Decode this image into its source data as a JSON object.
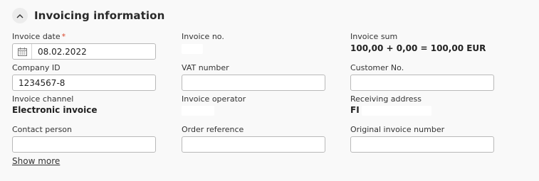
{
  "section": {
    "title": "Invoicing information",
    "collapse_icon": "chevron-up-icon"
  },
  "fields": {
    "invoice_date": {
      "label": "Invoice date",
      "required_mark": "*",
      "value": "08.02.2022",
      "icon": "calendar-icon"
    },
    "invoice_no": {
      "label": "Invoice no.",
      "value": ""
    },
    "invoice_sum": {
      "label": "Invoice sum",
      "value": "100,00 + 0,00 = 100,00 EUR"
    },
    "company_id": {
      "label": "Company ID",
      "value": "1234567-8"
    },
    "vat_number": {
      "label": "VAT number",
      "value": ""
    },
    "customer_no": {
      "label": "Customer No.",
      "value": ""
    },
    "invoice_channel": {
      "label": "Invoice channel",
      "value": "Electronic invoice"
    },
    "invoice_operator": {
      "label": "Invoice operator",
      "value": ""
    },
    "receiving_address": {
      "label": "Receiving address",
      "value": "FI"
    },
    "contact_person": {
      "label": "Contact person",
      "value": ""
    },
    "order_reference": {
      "label": "Order reference",
      "value": ""
    },
    "original_invoice_number": {
      "label": "Original invoice number",
      "value": ""
    }
  },
  "actions": {
    "show_more": "Show more"
  }
}
